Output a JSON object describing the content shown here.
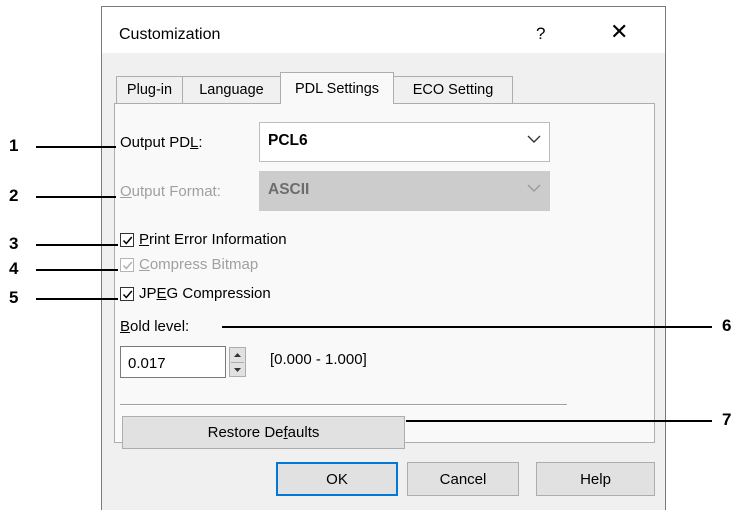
{
  "dialog": {
    "title": "Customization",
    "help_label": "?",
    "close_label": "✕"
  },
  "tabs": [
    {
      "label": "Plug-in",
      "active": false
    },
    {
      "label": "Language",
      "active": false
    },
    {
      "label": "PDL Settings",
      "active": true
    },
    {
      "label": "ECO Setting",
      "active": false
    }
  ],
  "output_pdl": {
    "label_pre": "Output PD",
    "label_key": "L",
    "label_post": ":",
    "value": "PCL6"
  },
  "output_format": {
    "label_key": "O",
    "label_rest": "utput Format:",
    "value": "ASCII",
    "disabled": true
  },
  "print_error": {
    "label_key": "P",
    "label_rest": "rint Error Information",
    "checked": true
  },
  "compress_bitmap": {
    "label_key": "C",
    "label_rest": "ompress Bitmap",
    "checked": true,
    "disabled": true
  },
  "jpeg_compression": {
    "label_pre": "JP",
    "label_key": "E",
    "label_post": "G Compression",
    "checked": true
  },
  "bold_level": {
    "label_key": "B",
    "label_rest": "old level:",
    "value": "0.017",
    "range": "[0.000 - 1.000]"
  },
  "restore_defaults": {
    "label_pre": "Restore De",
    "label_key": "f",
    "label_post": "aults"
  },
  "footer": {
    "ok": "OK",
    "cancel": "Cancel",
    "help": "Help"
  },
  "callouts": [
    "1",
    "2",
    "3",
    "4",
    "5",
    "6",
    "7"
  ]
}
